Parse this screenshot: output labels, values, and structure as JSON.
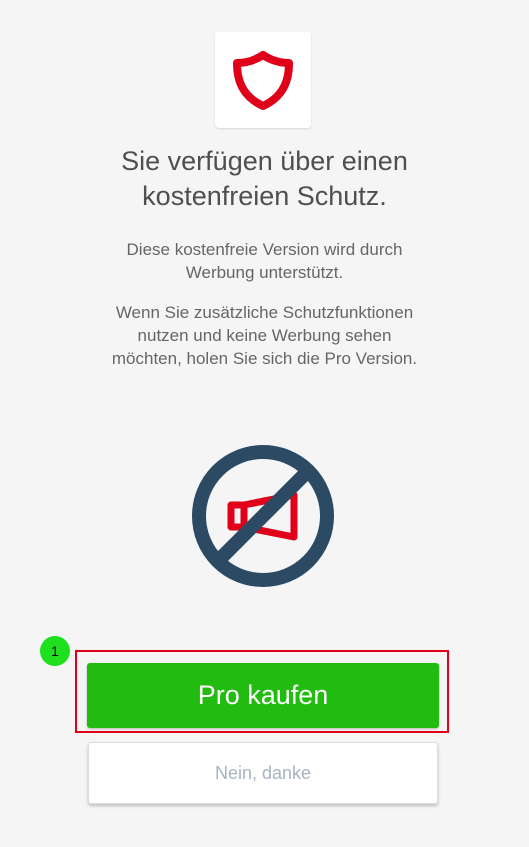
{
  "logo": {
    "icon": "shield-icon",
    "color": "#e0001a"
  },
  "headline": "Sie verfügen über einen\nkostenfreien Schutz.",
  "paragraphs": [
    "Diese kostenfreie Version wird durch\nWerbung unterstützt.",
    "Wenn Sie zusätzliche Schutzfunktionen\nnutzen und keine Werbung sehen\nmöchten, holen Sie sich die Pro Version."
  ],
  "illustration": {
    "icon": "no-ads-icon",
    "circle_color": "#2c4a63",
    "megaphone_color": "#e0001a"
  },
  "annotation": {
    "badge_label": "1",
    "badge_color": "#1ee01e",
    "box_color": "#e0001a"
  },
  "buttons": {
    "buy_label": "Pro kaufen",
    "buy_color": "#22bb10",
    "decline_label": "Nein, danke"
  }
}
